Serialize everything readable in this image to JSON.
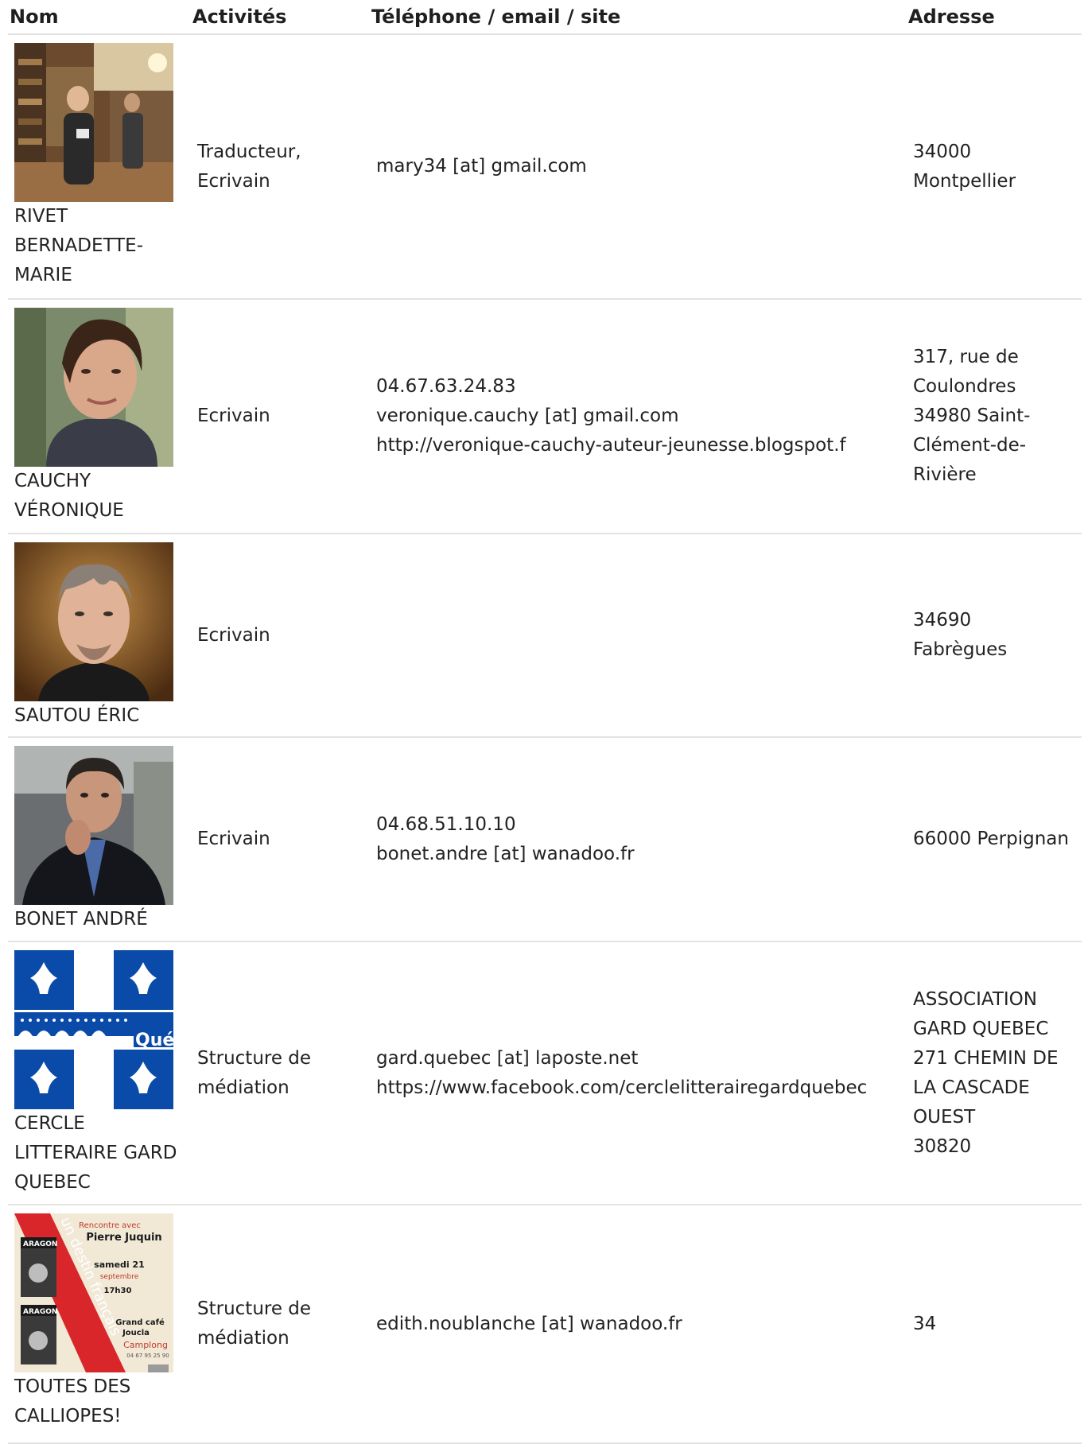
{
  "headers": {
    "nom": "Nom",
    "activites": "Activités",
    "contact": "Téléphone / email / site",
    "adresse": "Adresse"
  },
  "rows": [
    {
      "photo": "woman-in-library-photo",
      "name_lines": [
        "RIVET",
        "BERNADETTE-",
        "MARIE"
      ],
      "activity_lines": [
        "Traducteur,",
        "Ecrivain"
      ],
      "contact_lines": [
        "mary34 [at] gmail.com"
      ],
      "address_lines": [
        "34000",
        "Montpellier"
      ]
    },
    {
      "photo": "smiling-woman-portrait-photo",
      "name_lines": [
        "CAUCHY",
        "VÉRONIQUE"
      ],
      "activity_lines": [
        "Ecrivain"
      ],
      "contact_lines": [
        "04.67.63.24.83",
        "veronique.cauchy [at] gmail.com",
        "http://veronique-cauchy-auteur-jeunesse.blogspot.f"
      ],
      "address_lines": [
        "317, rue de",
        "Coulondres",
        "34980 Saint-",
        "Clément-de-",
        "Rivière"
      ]
    },
    {
      "photo": "man-portrait-photo",
      "name_lines": [
        "SAUTOU ÉRIC"
      ],
      "activity_lines": [
        "Ecrivain"
      ],
      "contact_lines": [],
      "address_lines": [
        "34690",
        "Fabrègues"
      ]
    },
    {
      "photo": "man-in-suit-photo",
      "name_lines": [
        "BONET ANDRÉ"
      ],
      "activity_lines": [
        "Ecrivain"
      ],
      "contact_lines": [
        "04.68.51.10.10",
        "bonet.andre [at] wanadoo.fr"
      ],
      "address_lines": [
        "66000 Perpignan"
      ]
    },
    {
      "photo": "quebec-flag-logo",
      "logo_text": "Qué",
      "name_lines": [
        "CERCLE",
        "LITTERAIRE GARD",
        "QUEBEC"
      ],
      "activity_lines": [
        "Structure de",
        "médiation"
      ],
      "contact_lines": [
        "gard.quebec [at] laposte.net",
        "https://www.facebook.com/cerclelitterairegardquebec"
      ],
      "address_lines": [
        "ASSOCIATION",
        "GARD QUEBEC",
        "271 CHEMIN DE",
        "LA CASCADE",
        "OUEST",
        "30820"
      ]
    },
    {
      "photo": "event-poster",
      "poster": {
        "rencontre": "Rencontre avec",
        "speaker": "Pierre Juquin",
        "date": "samedi 21",
        "month": "septembre",
        "time": "17h30",
        "place1": "Grand café",
        "place2": "Joucla",
        "town": "Camplong",
        "phone": "04 67 95 25 90",
        "book": "ARAGON",
        "banner": "un destin français"
      },
      "name_lines": [
        "TOUTES DES",
        "CALLIOPES!"
      ],
      "activity_lines": [
        "Structure de",
        "médiation"
      ],
      "contact_lines": [
        "edith.noublanche [at] wanadoo.fr"
      ],
      "address_lines": [
        "34"
      ]
    }
  ]
}
